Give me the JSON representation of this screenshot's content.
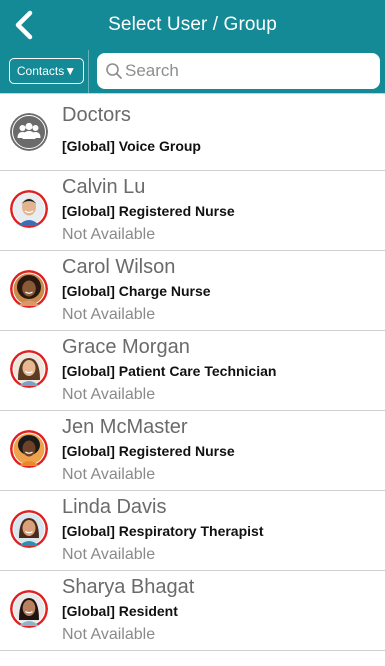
{
  "header": {
    "title": "Select User / Group",
    "background": "#138a96",
    "back_icon": "chevron-left-icon"
  },
  "toolbar": {
    "contacts_label": "Contacts▼",
    "search_placeholder": "Search",
    "search_value": "",
    "search_icon": "search-icon"
  },
  "list": [
    {
      "kind": "group",
      "name": "Doctors",
      "role": "[Global] Voice Group",
      "status": ""
    },
    {
      "kind": "user",
      "name": "Calvin Lu",
      "role": "[Global] Registered Nurse",
      "status": "Not Available"
    },
    {
      "kind": "user",
      "name": "Carol Wilson",
      "role": "[Global] Charge Nurse",
      "status": "Not Available"
    },
    {
      "kind": "user",
      "name": "Grace Morgan",
      "role": "[Global] Patient Care Technician",
      "status": "Not Available"
    },
    {
      "kind": "user",
      "name": "Jen McMaster",
      "role": "[Global] Registered Nurse",
      "status": "Not Available"
    },
    {
      "kind": "user",
      "name": "Linda Davis",
      "role": "[Global] Respiratory Therapist",
      "status": "Not Available"
    },
    {
      "kind": "user",
      "name": "Sharya Bhagat",
      "role": "[Global] Resident",
      "status": "Not Available"
    }
  ],
  "colors": {
    "accent": "#138a96",
    "unavailable_ring": "#e02020",
    "group_icon_bg": "#6b6b6b"
  }
}
